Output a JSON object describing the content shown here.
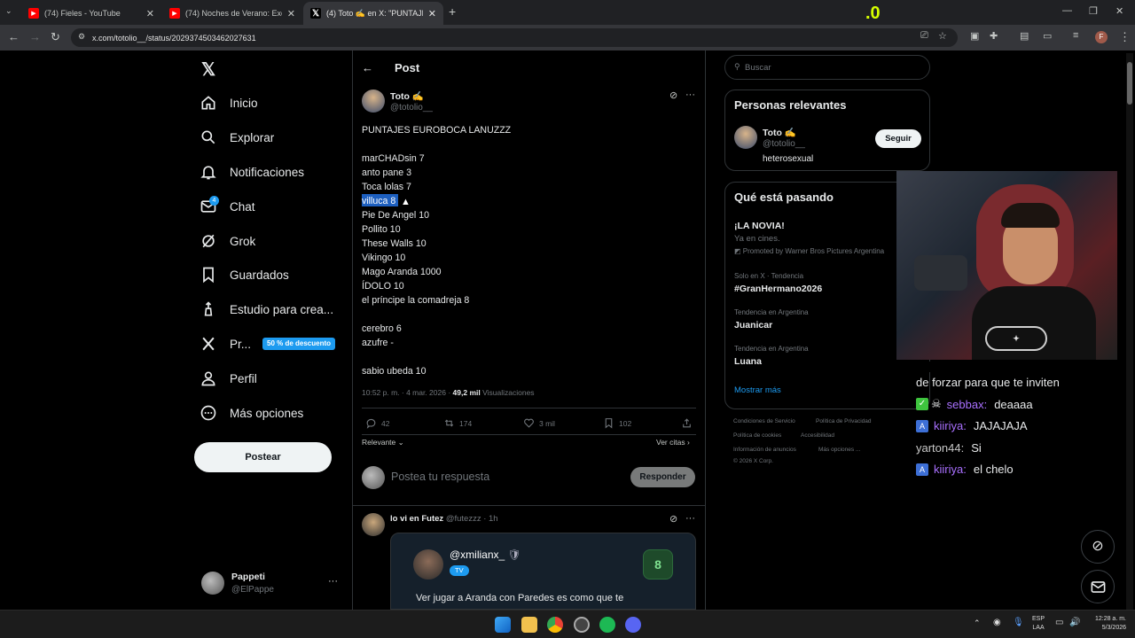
{
  "browser": {
    "tabs": [
      {
        "title": "(74) Fieles - YouTube"
      },
      {
        "title": "(74) Noches de Verano: Exceso"
      },
      {
        "title": "(4) Toto ✍ en X: \"PUNTAJES EU"
      }
    ],
    "url": "x.com/totolio__/status/2029374503462027631",
    "overlay_number": ".0"
  },
  "sidebar": {
    "items": [
      {
        "label": "Inicio",
        "icon": "home-icon"
      },
      {
        "label": "Explorar",
        "icon": "search-icon"
      },
      {
        "label": "Notificaciones",
        "icon": "bell-icon"
      },
      {
        "label": "Chat",
        "icon": "mail-icon",
        "badge": "4"
      },
      {
        "label": "Grok",
        "icon": "grok-icon"
      },
      {
        "label": "Guardados",
        "icon": "bookmark-icon"
      },
      {
        "label": "Estudio para crea...",
        "icon": "studio-icon"
      },
      {
        "label": "Pr...",
        "icon": "x-premium-icon",
        "promo": "50 % de descuento"
      },
      {
        "label": "Perfil",
        "icon": "person-icon"
      },
      {
        "label": "Más opciones",
        "icon": "more-icon"
      }
    ],
    "post_button": "Postear",
    "account": {
      "name": "Pappeti",
      "handle": "@ElPappe"
    }
  },
  "main": {
    "header": "Post",
    "tweet": {
      "author": "Toto ✍️",
      "handle": "@totolio__",
      "lines": [
        "PUNTAJES EUROBOCA LANUZZZ",
        "",
        "marCHADsin 7",
        "anto pane 3",
        "Toca lolas 7",
        "villuca 8",
        "Pie De Angel 10",
        "Pollito 10",
        "These Walls 10",
        "Vikingo 10",
        "Mago Aranda 1000",
        "ÍDOLO 10",
        "el príncipe la comadreja 8",
        "",
        "cerebro 6",
        "azufre -",
        "",
        "sabio ubeda 10"
      ],
      "timestamp": "10:52 p. m. · 4 mar. 2026 ·",
      "views": "49,2 mil",
      "views_label": "Visualizaciones",
      "replies": "42",
      "reposts": "174",
      "likes": "3 mil",
      "bookmarks": "102"
    },
    "sort_label": "Relevante",
    "quotes_link": "Ver citas",
    "reply_placeholder": "Postea tu respuesta",
    "reply_button": "Responder",
    "reply": {
      "author": "lo vi en Futez",
      "handle": "@futezzz",
      "time": "· 1h",
      "embed_handle": "@xmilianx_",
      "embed_tag": "TV",
      "embed_score": "8",
      "embed_text": "Ver jugar a Aranda con Paredes es como que te"
    }
  },
  "right": {
    "search_placeholder": "Buscar",
    "relevant": {
      "title": "Personas relevantes",
      "name": "Toto ✍️",
      "handle": "@totolio__",
      "bio": "heterosexual",
      "follow": "Seguir"
    },
    "trends": {
      "title": "Qué está pasando",
      "items": [
        {
          "context": "",
          "name": "¡LA NOVIA!",
          "sub": "Ya en cines.",
          "promo": "Promoted by Warner Bros Pictures Argentina"
        },
        {
          "context": "Solo en X · Tendencia",
          "name": "#GranHermano2026"
        },
        {
          "context": "Tendencia en Argentina",
          "name": "Juanicar"
        },
        {
          "context": "Tendencia en Argentina",
          "name": "Luana"
        }
      ],
      "more": "Mostrar más"
    },
    "footer": [
      "Condiciones de Servicio",
      "Política de Privacidad",
      "Política de cookies",
      "Accesibilidad",
      "Información de anuncios",
      "Más opciones ...",
      "© 2026 X Corp."
    ]
  },
  "stream_chat": [
    {
      "user": "",
      "text": "de forzar para que te inviten"
    },
    {
      "user": "sebbax:",
      "text": "deaaaa",
      "color": "#a970ff"
    },
    {
      "user": "kiiriya:",
      "text": "JAJAJAJA",
      "color": "#a970ff"
    },
    {
      "user": "yarton44:",
      "text": "Si",
      "color": "#c9c9c9"
    },
    {
      "user": "kiiriya:",
      "text": "el chelo",
      "color": "#a970ff"
    }
  ],
  "taskbar": {
    "lang1": "ESP",
    "lang2": "LAA",
    "time": "12:28 a. m.",
    "date": "5/3/2026"
  }
}
